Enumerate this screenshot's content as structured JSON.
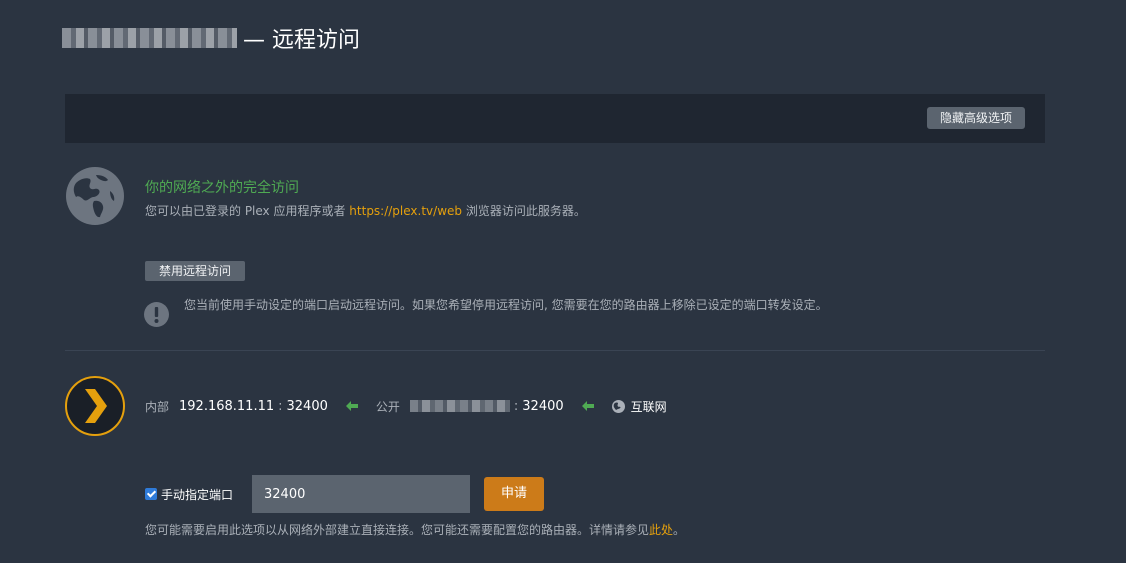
{
  "header": {
    "title": "— 远程访问"
  },
  "advanced": {
    "toggle_label": "隐藏高级选项"
  },
  "access": {
    "title": "你的网络之外的完全访问",
    "desc_before": "您可以由已登录的 Plex 应用程序或者 ",
    "desc_link": "https://plex.tv/web",
    "desc_after": " 浏览器访问此服务器。",
    "disable_label": "禁用远程访问",
    "warning": "您当前使用手动设定的端口启动远程访问。如果您希望停用远程访问, 您需要在您的路由器上移除已设定的端口转发设定。"
  },
  "connection": {
    "internal_label": "内部",
    "internal_ip": "192.168.11.11",
    "internal_port": "32400",
    "public_label": "公开",
    "public_port": "32400",
    "separator": ":",
    "internet_label": "互联网"
  },
  "manual_port": {
    "label": "手动指定端口",
    "checked": true,
    "value": "32400",
    "apply_label": "申请",
    "hint_before": "您可能需要启用此选项以从网络外部建立直接连接。您可能还需要配置您的路由器。详情请参见",
    "hint_link": "此处",
    "hint_after": "。"
  },
  "colors": {
    "background": "#2b3441",
    "success_green": "#4faa53",
    "link_orange": "#e5a00d",
    "apply_orange": "#cc7b19"
  }
}
